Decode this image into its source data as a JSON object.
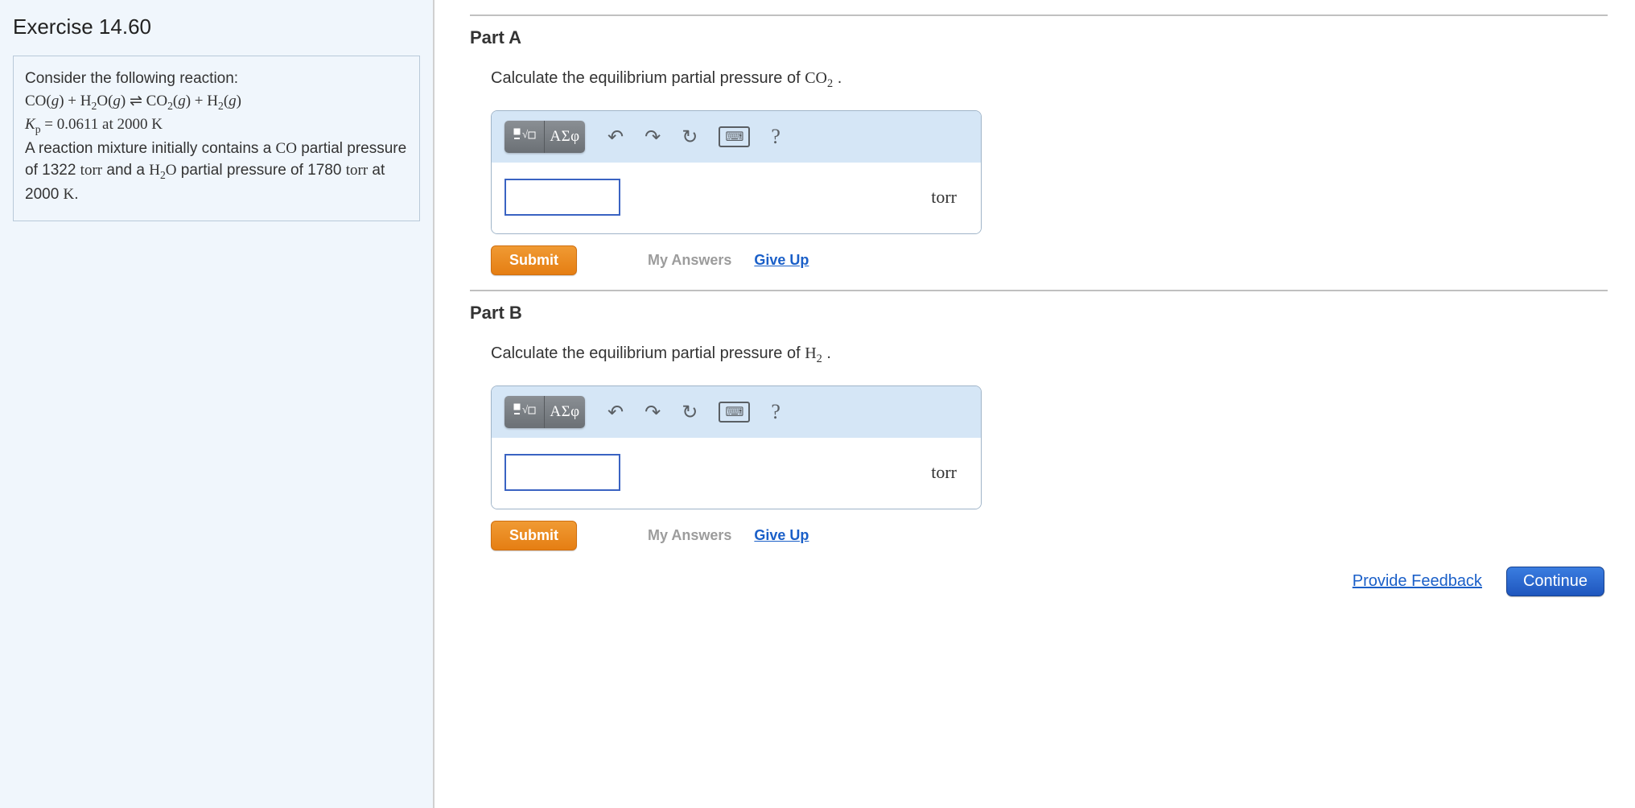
{
  "exercise_title": "Exercise 14.60",
  "problem": {
    "intro": "Consider the following reaction:",
    "kp_line_prefix": "K",
    "kp_subscript": "p",
    "kp_eq": " = 0.0611 at 2000 ",
    "kp_unit": "K",
    "blurb_a": "A reaction mixture initially contains a ",
    "co_text": "CO",
    "blurb_b": " partial pressure of 1322 ",
    "torr": "torr",
    "blurb_c": " and a ",
    "h2o_text": "H",
    "h2o_sub": "2",
    "h2o_text2": "O",
    "blurb_d": " partial pressure of 1780 ",
    "blurb_e": " at 2000 ",
    "k_unit": "K",
    "period": "."
  },
  "parts": {
    "a": {
      "title": "Part A",
      "prompt_pre": "Calculate the equilibrium partial pressure of ",
      "species_main": "CO",
      "species_sub": "2",
      "prompt_post": " .",
      "unit": "torr"
    },
    "b": {
      "title": "Part B",
      "prompt_pre": "Calculate the equilibrium partial pressure of ",
      "species_main": "H",
      "species_sub": "2",
      "prompt_post": " .",
      "unit": "torr"
    }
  },
  "toolbar": {
    "greek_label": "ΑΣφ",
    "help_symbol": "?"
  },
  "buttons": {
    "submit": "Submit",
    "my_answers": "My Answers",
    "give_up": "Give Up",
    "feedback": "Provide Feedback",
    "continue": "Continue"
  }
}
